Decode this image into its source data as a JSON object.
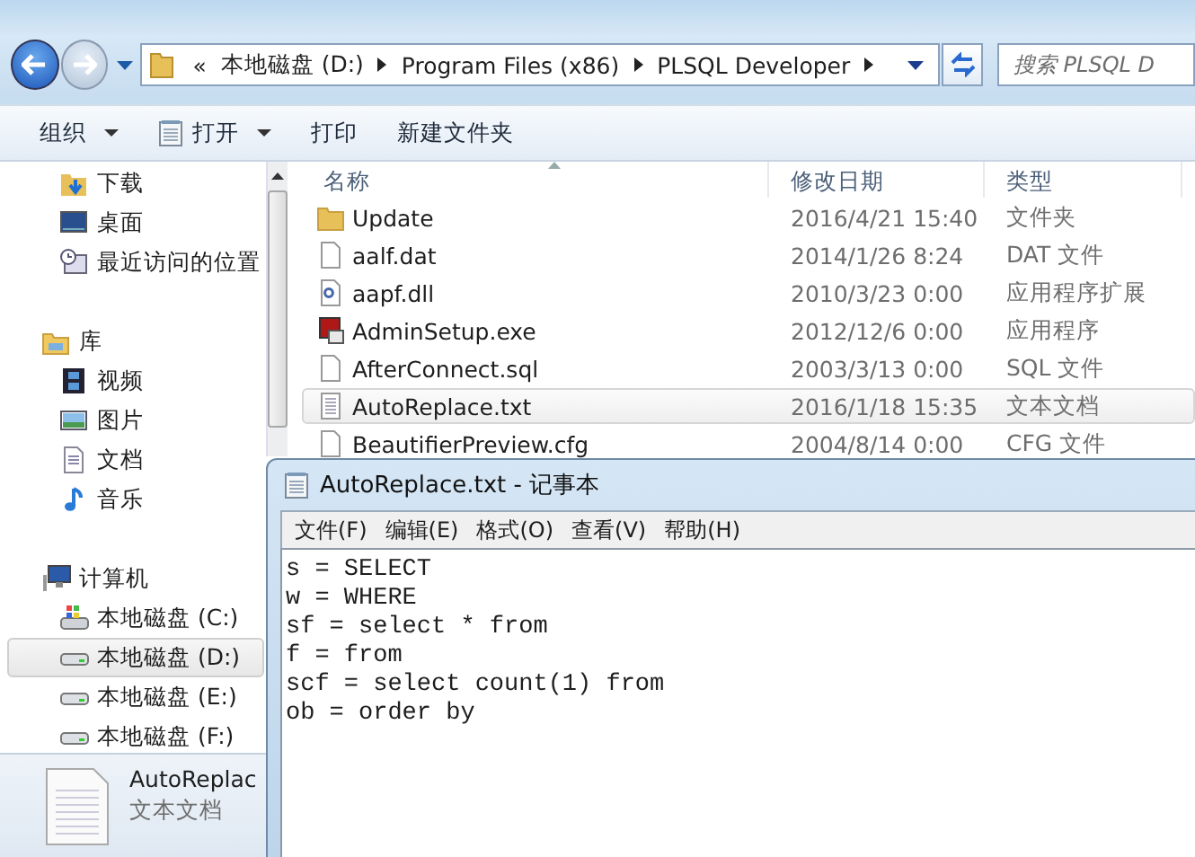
{
  "explorer": {
    "address": {
      "overflow": "«",
      "segments": [
        "本地磁盘 (D:)",
        "Program Files (x86)",
        "PLSQL Developer"
      ]
    },
    "search": {
      "placeholder": "搜索 PLSQL D"
    },
    "toolbar": [
      {
        "label": "组织",
        "dropdown": true
      },
      {
        "label": "打开",
        "dropdown": true
      },
      {
        "label": "打印",
        "dropdown": false
      },
      {
        "label": "新建文件夹",
        "dropdown": false
      }
    ],
    "sidebar": {
      "items": [
        {
          "label": "下载",
          "selected": false
        },
        {
          "label": "桌面",
          "selected": false
        },
        {
          "label": "最近访问的位置",
          "selected": false
        },
        {
          "label": "库",
          "selected": false,
          "children": [
            {
              "label": "视频",
              "selected": false
            },
            {
              "label": "图片",
              "selected": false
            },
            {
              "label": "文档",
              "selected": false
            },
            {
              "label": "音乐",
              "selected": false
            }
          ]
        },
        {
          "label": "计算机",
          "selected": false,
          "children": [
            {
              "label": "本地磁盘 (C:)",
              "selected": false
            },
            {
              "label": "本地磁盘 (D:)",
              "selected": true
            },
            {
              "label": "本地磁盘 (E:)",
              "selected": false
            },
            {
              "label": "本地磁盘 (F:)",
              "selected": false
            }
          ]
        }
      ]
    },
    "table": {
      "columns": [
        "名称",
        "修改日期",
        "类型"
      ],
      "rows": [
        {
          "kind": "folder",
          "name": "Update",
          "date": "2016/4/21 15:40",
          "type": "文件夹",
          "selected": false
        },
        {
          "kind": "file",
          "name": "aalf.dat",
          "date": "2014/1/26 8:24",
          "type": "DAT 文件",
          "selected": false
        },
        {
          "kind": "dll",
          "name": "aapf.dll",
          "date": "2010/3/23 0:00",
          "type": "应用程序扩展",
          "selected": false
        },
        {
          "kind": "exe",
          "name": "AdminSetup.exe",
          "date": "2012/12/6 0:00",
          "type": "应用程序",
          "selected": false
        },
        {
          "kind": "file",
          "name": "AfterConnect.sql",
          "date": "2003/3/13 0:00",
          "type": "SQL 文件",
          "selected": false
        },
        {
          "kind": "text",
          "name": "AutoReplace.txt",
          "date": "2016/1/18 15:35",
          "type": "文本文档",
          "selected": true
        },
        {
          "kind": "file",
          "name": "BeautifierPreview.cfg",
          "date": "2004/8/14 0:00",
          "type": "CFG 文件",
          "selected": false
        }
      ]
    },
    "details": {
      "name": "AutoReplac",
      "type": "文本文档"
    }
  },
  "notepad": {
    "title": "AutoReplace.txt - 记事本",
    "menu": [
      "文件(F)",
      "编辑(E)",
      "格式(O)",
      "查看(V)",
      "帮助(H)"
    ],
    "lines": [
      "s = SELECT",
      "w = WHERE",
      "sf = select * from",
      "f = from",
      "scf = select count(1) from",
      "ob = order by"
    ]
  }
}
